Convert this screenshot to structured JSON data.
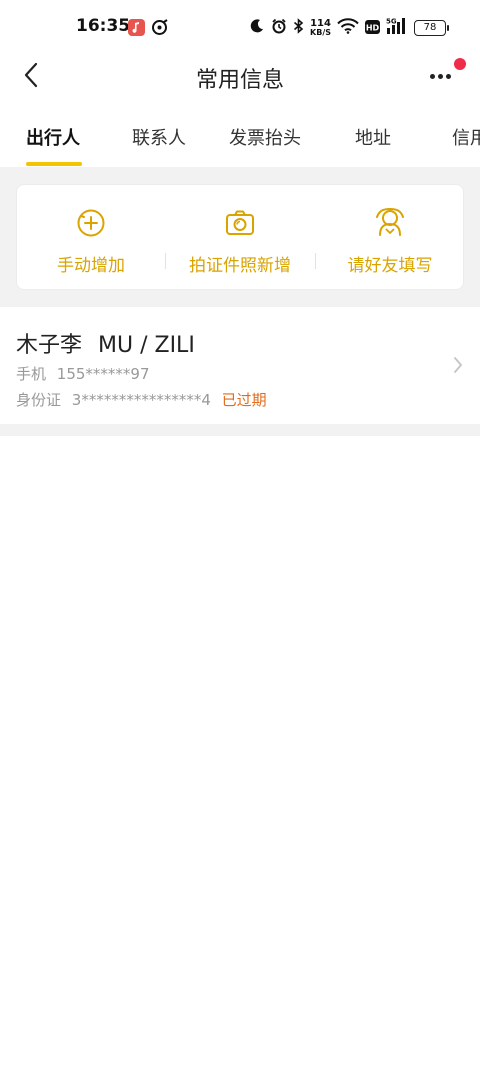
{
  "status_bar": {
    "time": "16:35",
    "net_speed_value": "114",
    "net_speed_unit": "KB/S",
    "battery": "78",
    "icons": [
      "moon-icon",
      "alarm-icon",
      "bluetooth-icon",
      "wifi-icon",
      "hd-icon",
      "signal-5g-icon",
      "battery-icon"
    ]
  },
  "header": {
    "title": "常用信息",
    "back_icon": "chevron-left-icon",
    "more_icon": "more-dots-icon"
  },
  "tabs": [
    {
      "label": "出行人",
      "active": true
    },
    {
      "label": "联系人",
      "active": false
    },
    {
      "label": "发票抬头",
      "active": false
    },
    {
      "label": "地址",
      "active": false
    },
    {
      "label": "信用",
      "active": false
    }
  ],
  "actions": [
    {
      "label": "手动增加",
      "icon": "plus-circle-icon"
    },
    {
      "label": "拍证件照新增",
      "icon": "camera-icon"
    },
    {
      "label": "请好友填写",
      "icon": "friend-icon"
    }
  ],
  "traveler": {
    "name": "木子李",
    "pinyin": "MU / ZILI",
    "phone_label": "手机",
    "phone": "155******97",
    "id_label": "身份证",
    "id_number": "3****************4",
    "status": "已过期"
  },
  "colors": {
    "accent": "#f5c400",
    "action_text": "#d9a400",
    "expired": "#e26b1c",
    "notification": "#ef2d4a",
    "page_gray": "#f2f2f3"
  }
}
